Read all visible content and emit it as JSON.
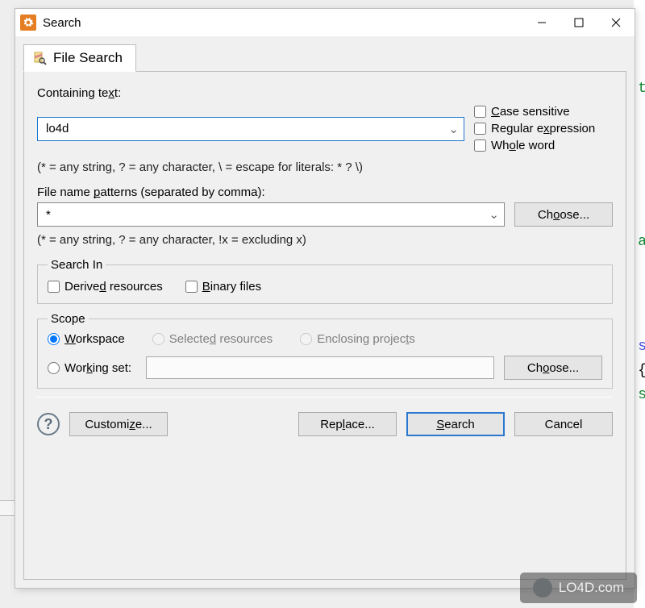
{
  "window": {
    "title": "Search"
  },
  "tab": {
    "label": "File Search"
  },
  "containing": {
    "label_prefix": "Containing te",
    "label_ul": "x",
    "label_suffix": "t:",
    "value": "lo4d",
    "hint": "(* = any string, ? = any character, \\ = escape for literals: * ? \\)"
  },
  "options": {
    "case_prefix": "",
    "case_ul": "C",
    "case_suffix": "ase sensitive",
    "regex_prefix": "Regular e",
    "regex_ul": "x",
    "regex_suffix": "pression",
    "whole_prefix": "Wh",
    "whole_ul": "o",
    "whole_suffix": "le word"
  },
  "patterns": {
    "label_prefix": "File name ",
    "label_ul": "p",
    "label_suffix": "atterns (separated by comma):",
    "value": "*",
    "choose_prefix": "Ch",
    "choose_ul": "o",
    "choose_suffix": "ose...",
    "hint": "(* = any string, ? = any character, !x = excluding x)"
  },
  "searchin": {
    "legend": "Search In",
    "derived_prefix": "Derive",
    "derived_ul": "d",
    "derived_suffix": " resources",
    "binary_ul": "B",
    "binary_suffix": "inary files"
  },
  "scope": {
    "legend": "Scope",
    "workspace_ul": "W",
    "workspace_suffix": "orkspace",
    "selected_prefix": "Selecte",
    "selected_ul": "d",
    "selected_suffix": " resources",
    "enclosing_prefix": "Enclosing projec",
    "enclosing_ul": "t",
    "enclosing_suffix": "s",
    "workingset_prefix": "Wor",
    "workingset_ul": "k",
    "workingset_suffix": "ing set:",
    "workingset_value": "",
    "choose_prefix": "Ch",
    "choose_ul": "o",
    "choose_suffix": "ose..."
  },
  "footer": {
    "customize_prefix": "Customi",
    "customize_ul": "z",
    "customize_suffix": "e...",
    "replace_prefix": "Rep",
    "replace_ul": "l",
    "replace_suffix": "ace...",
    "search_ul": "S",
    "search_suffix": "earch",
    "cancel": "Cancel"
  },
  "brand": "LO4D.com"
}
